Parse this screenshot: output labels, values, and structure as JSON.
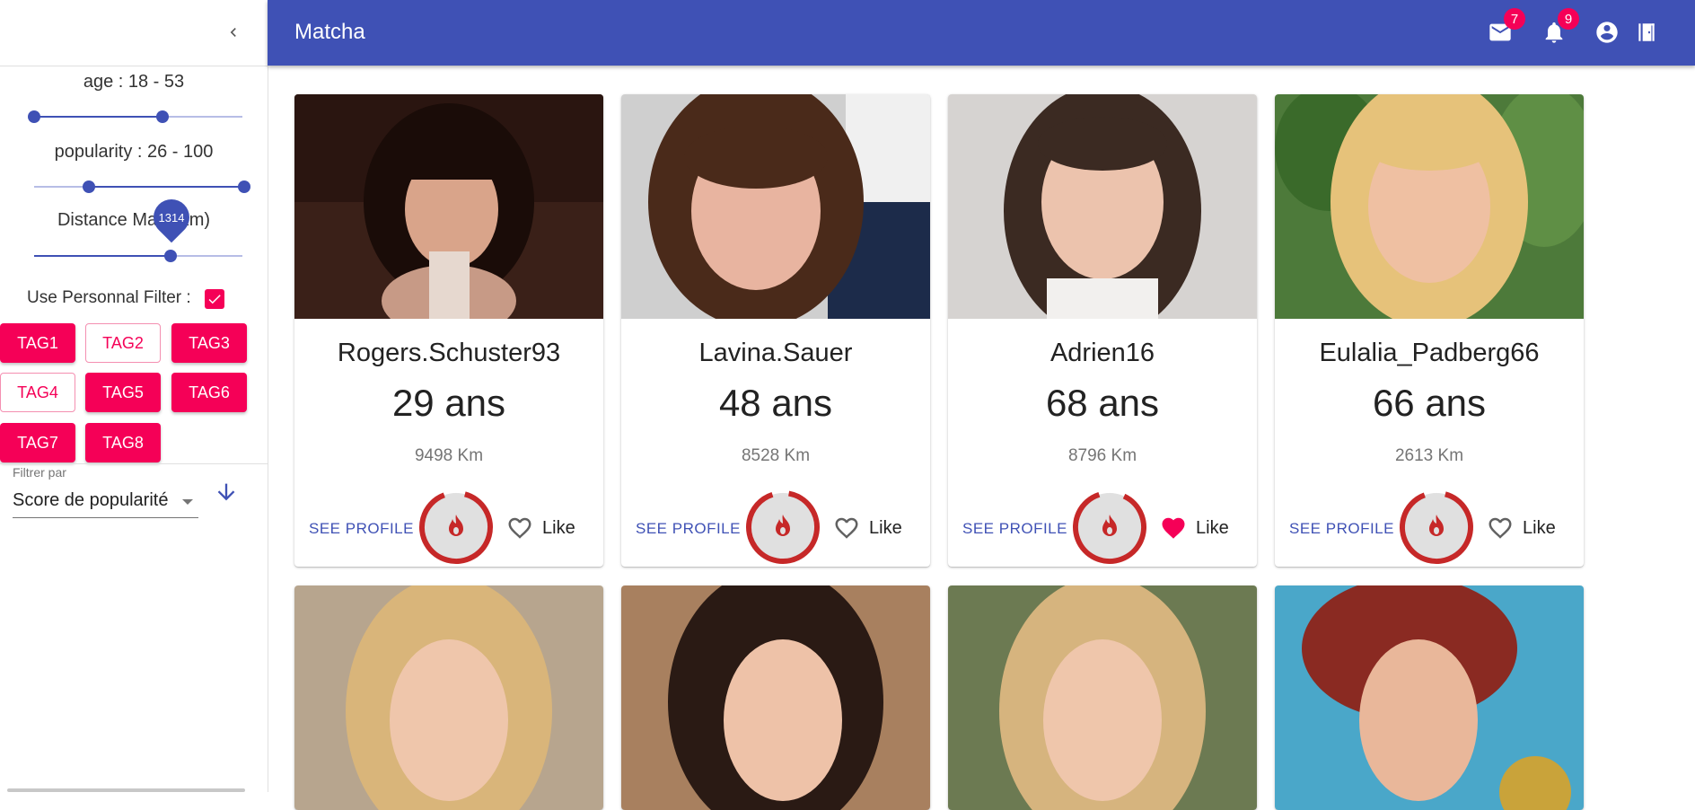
{
  "app": {
    "title": "Matcha"
  },
  "header": {
    "messages_count": "7",
    "notifications_count": "9"
  },
  "sidebar": {
    "age_label": "age : 18 - 53",
    "popularity_label": "popularity : 26 - 100",
    "distance_label": "Distance Max (Km)",
    "distance_value": "1314",
    "personal_filter_label": "Use Personnal Filter :",
    "personal_filter_checked": true,
    "tags": [
      {
        "label": "TAG1",
        "selected": true
      },
      {
        "label": "TAG2",
        "selected": false
      },
      {
        "label": "TAG3",
        "selected": true
      },
      {
        "label": "TAG4",
        "selected": false
      },
      {
        "label": "TAG5",
        "selected": true
      },
      {
        "label": "TAG6",
        "selected": true
      },
      {
        "label": "TAG7",
        "selected": true
      },
      {
        "label": "TAG8",
        "selected": true
      }
    ],
    "filter_label": "Filtrer par",
    "filter_value": "Score de popularité"
  },
  "cards": [
    {
      "username": "Rogers.Schuster93",
      "age": "29 ans",
      "distance": "9498 Km",
      "see_profile": "SEE PROFILE",
      "like_label": "Like",
      "liked": false
    },
    {
      "username": "Lavina.Sauer",
      "age": "48 ans",
      "distance": "8528 Km",
      "see_profile": "SEE PROFILE",
      "like_label": "Like",
      "liked": false
    },
    {
      "username": "Adrien16",
      "age": "68 ans",
      "distance": "8796 Km",
      "see_profile": "SEE PROFILE",
      "like_label": "Like",
      "liked": true
    },
    {
      "username": "Eulalia_Padberg66",
      "age": "66 ans",
      "distance": "2613 Km",
      "see_profile": "SEE PROFILE",
      "like_label": "Like",
      "liked": false
    }
  ],
  "colors": {
    "primary": "#3f51b5",
    "accent": "#f50057",
    "popularity_ring": "#c62828"
  }
}
